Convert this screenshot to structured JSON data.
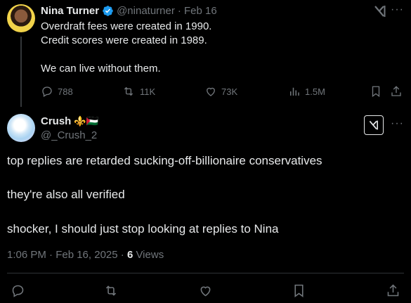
{
  "tweet1": {
    "name": "Nina Turner",
    "handle": "@ninaturner",
    "date": "· Feb 16",
    "lines": [
      "Overdraft fees were created in 1990.",
      "Credit scores were created in 1989.",
      "",
      "We can live without them."
    ],
    "actions": {
      "replies": "788",
      "reposts": "11K",
      "likes": "73K",
      "views": "1.5M"
    },
    "brand_icon": "xai-logo-icon"
  },
  "tweet2": {
    "name": "Crush",
    "emoji": "⚜️🇵🇸",
    "handle": "@_Crush_2",
    "paragraphs": [
      "top replies are retarded sucking-off-billionaire conservatives",
      "they're also all verified",
      "shocker, I should just stop looking at replies to Nina"
    ],
    "timestamp": "1:06 PM · Feb 16, 2025 · ",
    "views_count": "6",
    "views_label": " Views"
  },
  "colors": {
    "background": "#000000",
    "text": "#e7e9ea",
    "muted": "#71767b",
    "verified": "#1d9bf0",
    "divider": "#2f3336"
  }
}
